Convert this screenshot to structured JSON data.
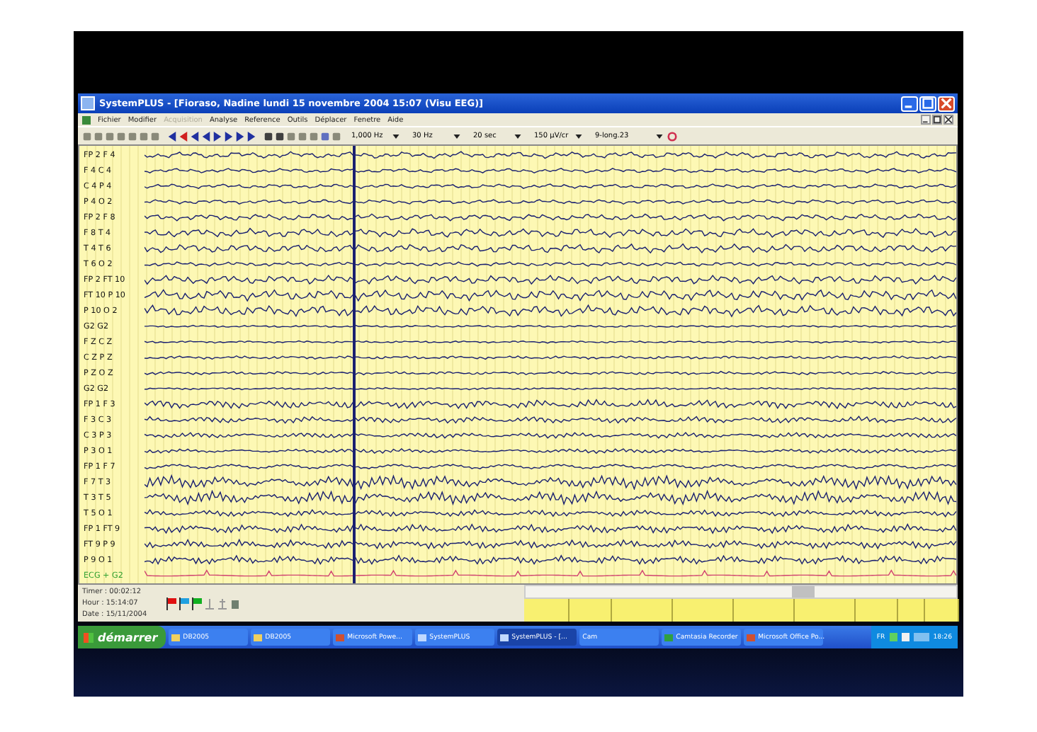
{
  "window": {
    "title": "SystemPLUS - [Fioraso, Nadine lundi 15 novembre 2004 15:07 (Visu EEG)]"
  },
  "menu": [
    {
      "label": "Fichier",
      "disabled": false
    },
    {
      "label": "Modifier",
      "disabled": false
    },
    {
      "label": "Acquisition",
      "disabled": true
    },
    {
      "label": "Analyse",
      "disabled": false
    },
    {
      "label": "Reference",
      "disabled": false
    },
    {
      "label": "Outils",
      "disabled": false
    },
    {
      "label": "Déplacer",
      "disabled": false
    },
    {
      "label": "Fenetre",
      "disabled": false
    },
    {
      "label": "Aide",
      "disabled": false
    }
  ],
  "toolbar": {
    "dropdowns": [
      "1,000 Hz",
      "30 Hz",
      "20 sec",
      "150 µV/cr",
      "9-long.23"
    ]
  },
  "channels": [
    {
      "label": "FP 2 F 4",
      "kind": "eeg"
    },
    {
      "label": "F 4 C 4",
      "kind": "eeg"
    },
    {
      "label": "C 4 P 4",
      "kind": "eeg"
    },
    {
      "label": "P 4 O 2",
      "kind": "eeg"
    },
    {
      "label": "FP 2 F 8",
      "kind": "eeg"
    },
    {
      "label": "F 8 T 4",
      "kind": "eeg"
    },
    {
      "label": "T 4 T 6",
      "kind": "eeg"
    },
    {
      "label": "T 6 O 2",
      "kind": "eeg"
    },
    {
      "label": "FP 2 FT 10",
      "kind": "eeg"
    },
    {
      "label": "FT 10 P 10",
      "kind": "eeg"
    },
    {
      "label": "P 10 O 2",
      "kind": "eeg"
    },
    {
      "label": "G2 G2",
      "kind": "eeg"
    },
    {
      "label": "F Z C Z",
      "kind": "eeg"
    },
    {
      "label": "C Z P Z",
      "kind": "eeg"
    },
    {
      "label": "P Z O Z",
      "kind": "eeg"
    },
    {
      "label": "G2 G2",
      "kind": "eeg"
    },
    {
      "label": "FP 1 F 3",
      "kind": "eeg"
    },
    {
      "label": "F 3 C 3",
      "kind": "eeg"
    },
    {
      "label": "C 3 P 3",
      "kind": "eeg"
    },
    {
      "label": "P 3 O 1",
      "kind": "eeg"
    },
    {
      "label": "FP 1 F 7",
      "kind": "eeg"
    },
    {
      "label": "F 7 T 3",
      "kind": "eeg"
    },
    {
      "label": "T 3 T 5",
      "kind": "eeg"
    },
    {
      "label": "T 5 O 1",
      "kind": "eeg"
    },
    {
      "label": "FP 1 FT 9",
      "kind": "eeg"
    },
    {
      "label": "FT 9 P 9",
      "kind": "eeg"
    },
    {
      "label": "P 9 O 1",
      "kind": "eeg"
    },
    {
      "label": "ECG + G2",
      "kind": "ecg"
    }
  ],
  "status": {
    "lines": [
      "Timer : 00:02:12",
      "Hour : 15:14:07",
      "Date : 15/11/2004"
    ],
    "flags": [
      {
        "color": "#e01010"
      },
      {
        "color": "#20a0e0"
      },
      {
        "color": "#10b020"
      }
    ]
  },
  "taskbar": {
    "start": "démarrer",
    "items": [
      {
        "label": "DB2005",
        "kind": "folder",
        "selected": false
      },
      {
        "label": "DB2005",
        "kind": "folder",
        "selected": false
      },
      {
        "label": "Microsoft Powe...",
        "kind": "slides",
        "selected": false
      },
      {
        "label": "SystemPLUS",
        "kind": "app",
        "selected": false
      },
      {
        "label": "SystemPLUS - [...",
        "kind": "app",
        "selected": true
      },
      {
        "label": "Cam",
        "kind": "plain",
        "selected": false
      },
      {
        "label": "Camtasia Recorder",
        "kind": "recorder",
        "selected": false
      },
      {
        "label": "Microsoft Office Po...",
        "kind": "slides",
        "selected": false
      }
    ],
    "tray_lang": "FR",
    "clock": "18:26"
  }
}
